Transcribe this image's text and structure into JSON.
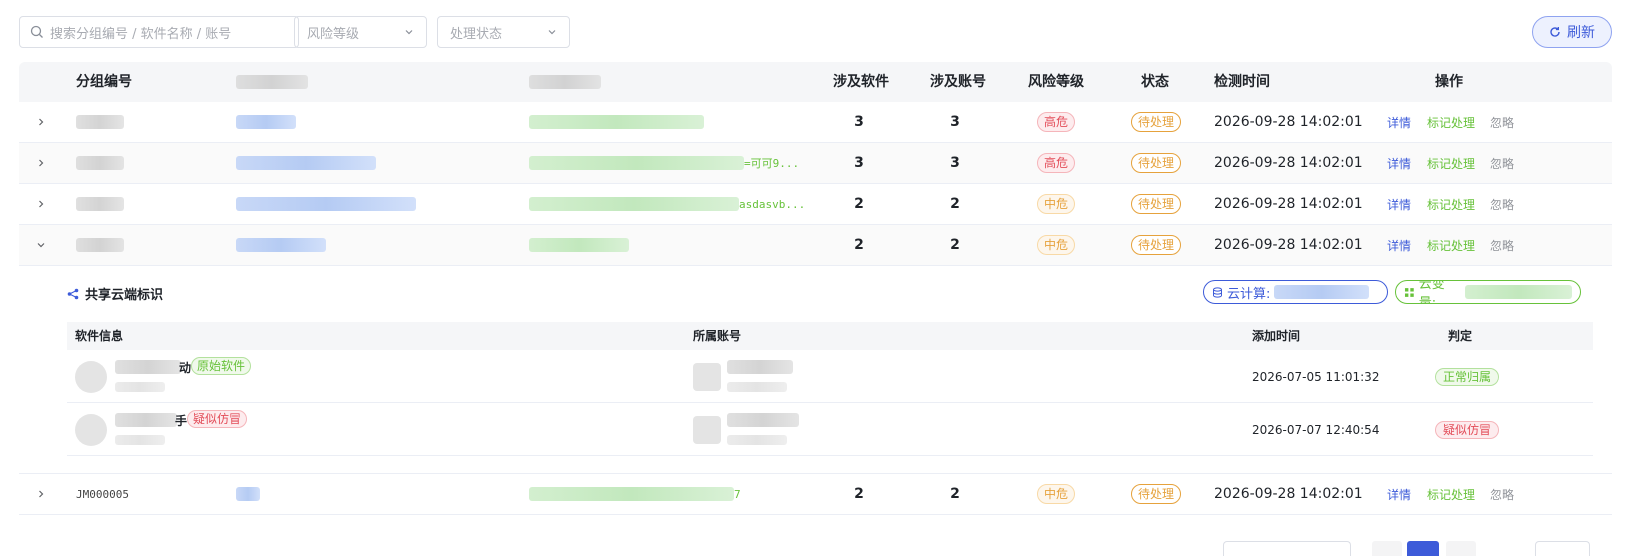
{
  "filters": {
    "search_placeholder": "搜索分组编号 / 软件名称 / 账号",
    "risk_level_placeholder": "风险等级",
    "status_placeholder": "处理状态",
    "refresh_label": "刷新"
  },
  "table": {
    "headers": {
      "group_id": "分组编号",
      "software_count": "涉及软件",
      "account_count": "涉及账号",
      "risk_level": "风险等级",
      "status": "状态",
      "detect_time": "检测时间",
      "actions": "操作"
    },
    "rows": [
      {
        "software": "3",
        "accounts": "3",
        "risk": "高危",
        "status": "待处理",
        "time": "2026-09-28 14:02:01",
        "col3_tail": ""
      },
      {
        "software": "3",
        "accounts": "3",
        "risk": "高危",
        "status": "待处理",
        "time": "2026-09-28 14:02:01",
        "col3_tail": "=可可9..."
      },
      {
        "software": "2",
        "accounts": "2",
        "risk": "中危",
        "status": "待处理",
        "time": "2026-09-28 14:02:01",
        "col3_tail": "asdasvb..."
      },
      {
        "software": "2",
        "accounts": "2",
        "risk": "中危",
        "status": "待处理",
        "time": "2026-09-28 14:02:01",
        "col3_tail": ""
      },
      {
        "group_id": "JM000005",
        "software": "2",
        "accounts": "2",
        "risk": "中危",
        "status": "待处理",
        "time": "2026-09-28 14:02:01",
        "col3_tail": "7"
      }
    ],
    "actions": {
      "detail": "详情",
      "mark": "标记处理",
      "ignore": "忽略"
    }
  },
  "expanded": {
    "title": "共享云端标识",
    "compute_label": "云计算:",
    "var_label": "云变量:",
    "sub_headers": {
      "software_info": "软件信息",
      "account": "所属账号",
      "added_time": "添加时间",
      "verdict": "判定"
    },
    "sub_rows": [
      {
        "name_tail": "动",
        "tag": "原始软件",
        "added_time": "2026-07-05 11:01:32",
        "verdict": "正常归属"
      },
      {
        "name_tail": "手",
        "tag": "疑似仿冒",
        "added_time": "2026-07-07 12:40:54",
        "verdict": "疑似仿冒"
      }
    ]
  },
  "colors": {
    "primary": "#3d5bd9",
    "success": "#67c23a",
    "danger": "#e34d59",
    "warning": "#e6a23c"
  },
  "icons": {
    "search": "search-icon",
    "refresh": "refresh-icon",
    "share": "share-icon",
    "database": "database-icon",
    "grid": "grid-icon",
    "expand": "chevron-right-icon",
    "collapse": "chevron-down-icon",
    "select": "chevron-down-icon"
  }
}
